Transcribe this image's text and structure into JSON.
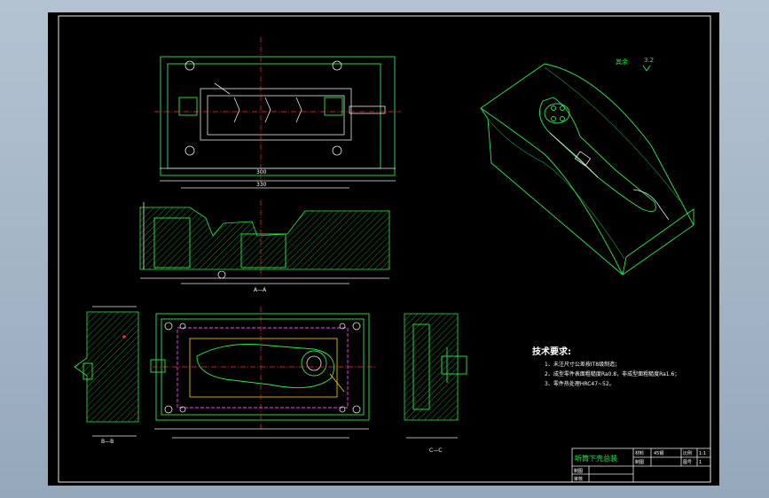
{
  "drawing": {
    "roughness_note": "其余",
    "roughness_value": "3.2",
    "section_labels": {
      "front": "A—A",
      "left": "B—B",
      "right": "C—C"
    },
    "tech_requirements": {
      "title": "技术要求:",
      "items": [
        "1、未注尺寸公差按IT8级制造；",
        "2、成型零件表面粗糙度Ra0.8，非成型面粗糙度Ra1.6；",
        "3、零件热处理HRC47~52。"
      ]
    },
    "title_block": {
      "drawing_name": "听筒下壳总装",
      "label_material": "材料",
      "label_scale": "比例",
      "label_drawer": "制图",
      "label_sheet": "图号",
      "label_review": "审核",
      "material_value": "45钢",
      "scale_value": "1:1",
      "sheet_value": "1"
    }
  },
  "colors": {
    "background_frame": "#a6b7c8",
    "sheet": "#000000",
    "outline": "#2fe84a",
    "dimension": "#e8e8e8",
    "centerline": "#ff3030",
    "hidden": "#ff40ff",
    "text": "#ffffff"
  }
}
